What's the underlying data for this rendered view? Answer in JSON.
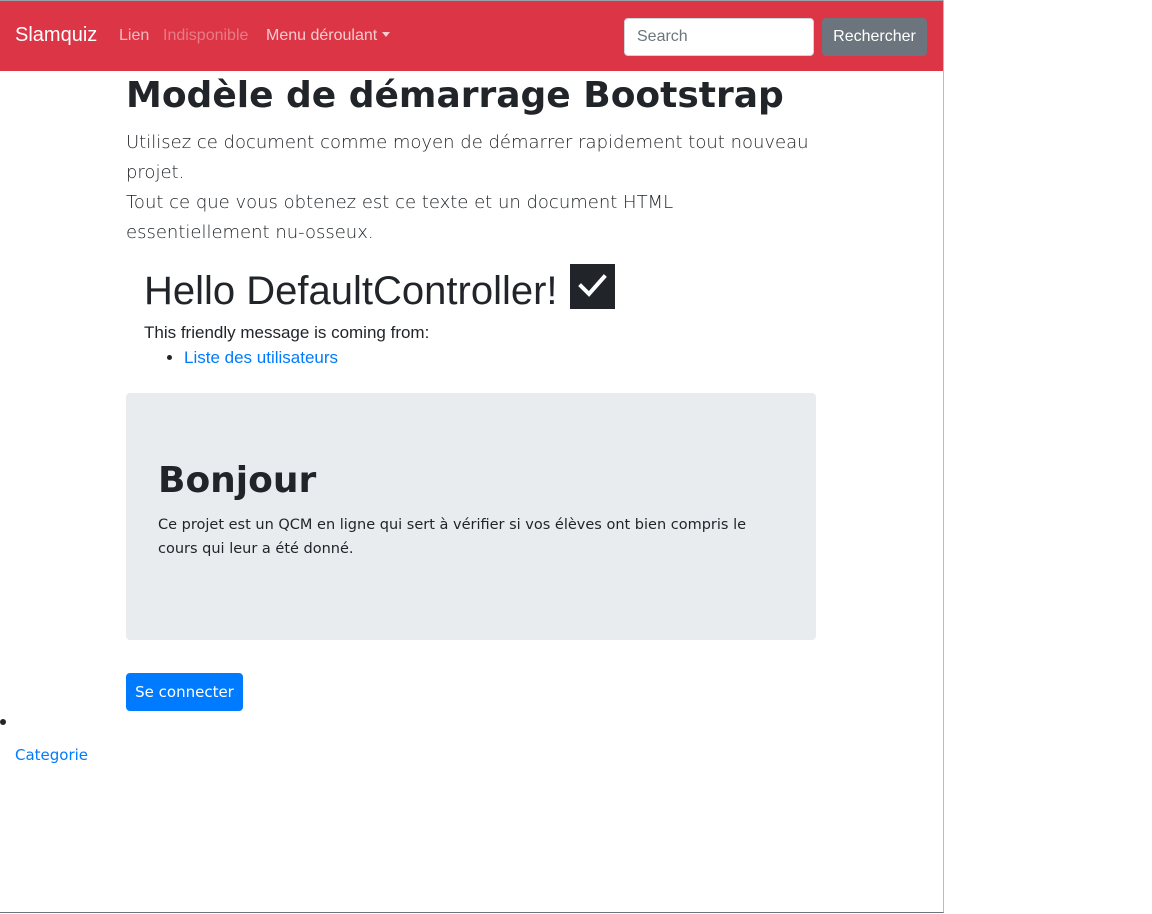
{
  "navbar": {
    "brand": "Slamquiz",
    "links": [
      {
        "label": "Lien"
      },
      {
        "label": "Indisponible"
      },
      {
        "label": "Menu déroulant"
      }
    ],
    "search_placeholder": "Search",
    "search_button": "Rechercher",
    "bg_color": "#dc3545"
  },
  "main": {
    "title": "Modèle de démarrage Bootstrap",
    "lead_line1": "Utilisez ce document comme moyen de démarrer rapidement tout nouveau projet.",
    "lead_line2": "Tout ce que vous obtenez est ce texte et un document HTML essentiellement nu-osseux."
  },
  "hello": {
    "heading": "Hello DefaultController!",
    "check_icon": "check-icon",
    "friendly_text": "This friendly message is coming from:",
    "list": [
      {
        "label": "Liste des utilisateurs"
      }
    ]
  },
  "jumbotron": {
    "title": "Bonjour",
    "text": "Ce projet est un QCM en ligne qui sert à vérifier si vos élèves ont bien compris le cours qui leur a été donné."
  },
  "actions": {
    "connect_button": "Se connecter",
    "category_link": "Categorie"
  },
  "colors": {
    "primary": "#007bff",
    "secondary": "#6c757d",
    "danger": "#dc3545",
    "jumbotron_bg": "#e9ecef"
  }
}
